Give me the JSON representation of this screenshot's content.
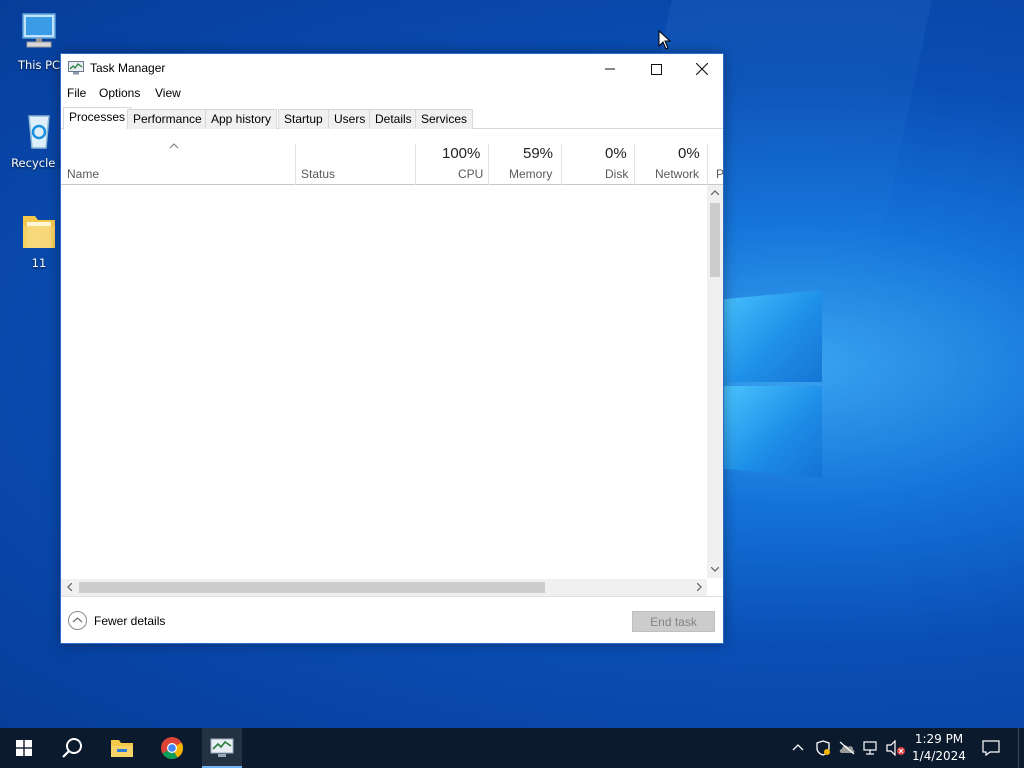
{
  "desktop": {
    "icons": [
      {
        "label": "This PC"
      },
      {
        "label": "Recycle B"
      },
      {
        "label": "11"
      }
    ]
  },
  "window": {
    "title": "Task Manager",
    "menu": [
      "File",
      "Options",
      "View"
    ],
    "tabs": [
      "Processes",
      "Performance",
      "App history",
      "Startup",
      "Users",
      "Details",
      "Services"
    ],
    "active_tab": "Processes",
    "columns": {
      "name": "Name",
      "status": "Status",
      "cpu": {
        "pct": "100%",
        "label": "CPU"
      },
      "memory": {
        "pct": "59%",
        "label": "Memory"
      },
      "disk": {
        "pct": "0%",
        "label": "Disk"
      },
      "network": {
        "pct": "0%",
        "label": "Network"
      },
      "power_truncated": "P"
    },
    "footer": {
      "fewer_details": "Fewer details",
      "end_task": "End task"
    }
  },
  "taskbar": {
    "clock": {
      "time": "1:29 PM",
      "date": "1/4/2024"
    }
  },
  "colors": {
    "taskbar": "#0c1a2e",
    "window_border": "#2a6cc7",
    "desktop_accent": "#1472d8"
  }
}
